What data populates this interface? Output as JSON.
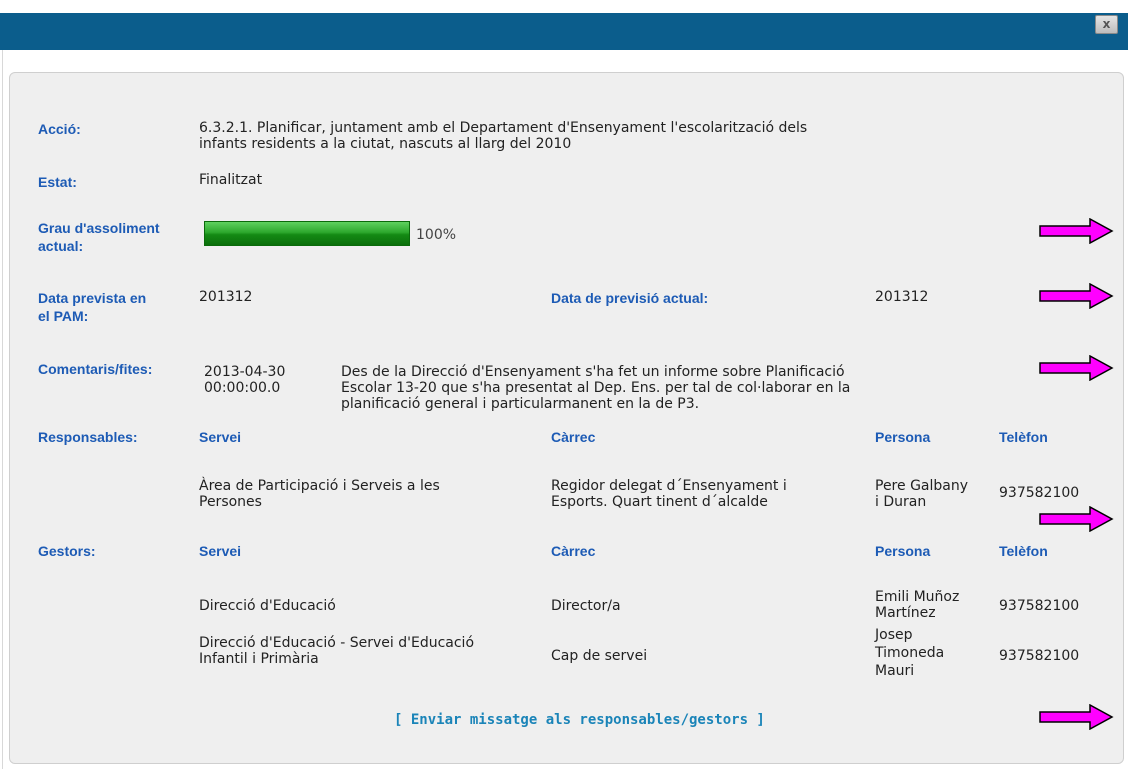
{
  "window": {
    "close_label": "x"
  },
  "accio": {
    "label": "Acció:",
    "line1": "6.3.2.1. Planificar, juntament amb el Departament d'Ensenyament l'escolarització dels",
    "line2": "infants residents a la ciutat, nascuts al llarg del 2010"
  },
  "estat": {
    "label": "Estat:",
    "value": "Finalitzat"
  },
  "grau": {
    "label1": "Grau d'assoliment",
    "label2": "actual:",
    "percent_text": "100%",
    "progress_fraction": 1.0
  },
  "data": {
    "prevista_label1": "Data prevista en",
    "prevista_label2": "el PAM:",
    "prevista_value": "201312",
    "actual_label": "Data de previsió actual:",
    "actual_value": "201312"
  },
  "comentaris": {
    "label": "Comentaris/fites:",
    "date1": "2013-04-30",
    "date2": "00:00:00.0",
    "text1": "Des de la Direcció d'Ensenyament s'ha fet un informe sobre Planificació",
    "text2": "Escolar 13-20 que s'ha presentat al Dep. Ens. per tal de col·laborar en la",
    "text3": "planificació general i particularmanent en la de P3."
  },
  "responsables": {
    "label": "Responsables:",
    "headers": {
      "servei": "Servei",
      "carrec": "Càrrec",
      "persona": "Persona",
      "telefon": "Telèfon"
    },
    "rows": [
      {
        "servei1": "Àrea de Participació i Serveis a les",
        "servei2": "Persones",
        "carrec1": "Regidor delegat d´Ensenyament i",
        "carrec2": "Esports. Quart tinent d´alcalde",
        "persona1": "Pere Galbany",
        "persona2": "i Duran",
        "telefon": "937582100"
      }
    ]
  },
  "gestors": {
    "label": "Gestors:",
    "headers": {
      "servei": "Servei",
      "carrec": "Càrrec",
      "persona": "Persona",
      "telefon": "Telèfon"
    },
    "rows": [
      {
        "servei1": "Direcció d'Educació",
        "servei2": "",
        "carrec": "Director/a",
        "persona1": "Emili Muñoz",
        "persona2": "Martínez",
        "persona3": "",
        "telefon": "937582100"
      },
      {
        "servei1": "Direcció d'Educació - Servei d'Educació",
        "servei2": "Infantil i Primària",
        "carrec": "Cap de servei",
        "persona1": "Josep",
        "persona2": "Timoneda",
        "persona3": "Mauri",
        "telefon": "937582100"
      }
    ]
  },
  "footer": {
    "link": "[ Enviar missatge als responsables/gestors ]"
  },
  "colors": {
    "label_blue": "#1d5bb5",
    "link_blue": "#1a84b8",
    "titlebar": "#0b5d8c",
    "arrow_magenta": "#ff00ff",
    "progress_green": "#2da82d"
  },
  "icons": {
    "arrow": "right-arrow-icon"
  }
}
